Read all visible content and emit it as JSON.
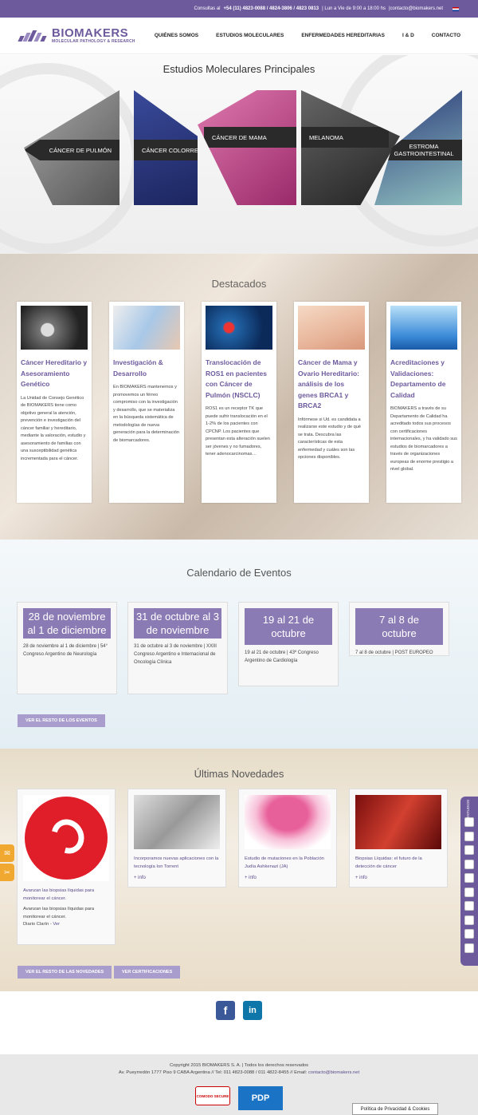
{
  "topbar": {
    "prefix": "Consultas al",
    "phones": "+54 (11) 4823-0088 / 4824-3806 / 4823 0813",
    "hours": "| Lun a Vie de 9:00 a 18:00 hs",
    "email": "|contacto@biomakers.net"
  },
  "logo": {
    "name": "BIOMAKERS",
    "sub": "MOLECULAR PATHOLOGY & RESEARCH"
  },
  "menu": [
    "QUIÉNES SOMOS",
    "ESTUDIOS MOLECULARES",
    "ENFERMEDADES HEREDITARIAS",
    "I & D",
    "CONTACTO"
  ],
  "estudios": {
    "title": "Estudios Moleculares Principales",
    "panels": [
      "CÁNCER DE PULMÓN",
      "CÁNCER COLORRECTAL",
      "CÁNCER DE MAMA",
      "MELANOMA",
      "ESTROMA GASTROINTESTINAL"
    ]
  },
  "destacados": {
    "title": "Destacados",
    "cards": [
      {
        "title": "Cáncer Hereditario y Asesoramiento Genético",
        "text": "La Unidad de Consejo Genético de BIOMAKERS tiene como objetivo general la atención, prevención e investigación del cáncer familiar y hereditario, mediante la valoración, estudio y asesoramiento de familias con una susceptibilidad genética incrementada para el cáncer."
      },
      {
        "title": "Investigación & Desarrollo",
        "text": "En BIOMAKERS mantenemos y promovemos un férreo compromiso con la investigación y desarrollo, que se materializa en la búsqueda sistemática de metodologías de nueva generación para la determinación de biomarcadores."
      },
      {
        "title": "Translocación de ROS1 en pacientes con Cáncer de Pulmón (NSCLC)",
        "text": "ROS1 es un receptor TK que puede sufrir translocación en el 1-2% de los pacientes con CPCNP. Los pacientes que presentan esta alteración suelen ser jóvenes y no fumadores, tener adenocarcinomas…"
      },
      {
        "title": "Cáncer de Mama y Ovario Hereditario: análisis de los genes BRCA1 y BRCA2",
        "text": "Infórmese si Ud. es candidata a realizarse este estudio y de qué se trata. Descubra las características de esta enfermedad y cuáles son las opciones disponibles."
      },
      {
        "title": "Acreditaciones y Validaciones: Departamento de Calidad",
        "text": "BIOMAKERS a través de su Departamento de Calidad ha acreditado todos sus procesos con certificaciones internacionales, y ha validado sus estudios de biomarcadores a través de organizaciones europeas de enorme prestigio a nivel global."
      }
    ]
  },
  "eventos": {
    "title": "Calendario de Eventos",
    "button": "VER EL RESTO DE LOS EVENTOS",
    "items": [
      {
        "date": "28 de noviembre al 1 de diciembre",
        "desc": "28 de noviembre al 1 de diciembre | 54° Congreso Argentino de Neurología"
      },
      {
        "date": "31 de octubre al 3 de noviembre",
        "desc": "31 de octubre al 3 de noviembre | XXIII Congreso Argentino e Internacional de Oncología Clínica"
      },
      {
        "date": "19 al 21 de octubre",
        "desc": "19 al 21 de octubre | 43º Congreso Argentino de Cardiología"
      },
      {
        "date": "7 al 8 de octubre",
        "desc": "7 al 8 de octubre | POST EUROPEO"
      }
    ]
  },
  "novedades": {
    "title": "Últimas Novedades",
    "button1": "VER EL RESTO DE LAS NOVEDADES",
    "button2": "VER CERTIFICACIONES",
    "items": [
      {
        "title": "Avanzan las biopsias líquidas para monitorear el cáncer.",
        "extra": "Avanzan las biopsias líquidas para monitorear el cáncer.",
        "source": "Diario Clarín -",
        "link": "Ver"
      },
      {
        "title": "Incorporamos nuevas aplicaciones con la tecnología Ion Torrent",
        "more": "+ info"
      },
      {
        "title": "Estudio de mutaciones en la Población Judía Ashkenazi (JA)",
        "more": "+ info"
      },
      {
        "title": "Biopsias Líquidas: el futuro de la detección de cáncer",
        "more": "+ info"
      }
    ]
  },
  "footer": {
    "line1": "Copyright 2015 BIOMAKERS S. A. | Todos los derechos reservados",
    "line2": "Av. Pueyrredón 1777 Piso 9 CABA Argentina // Tel: 011 4823-0088 / 011 4822-8455 // Email:",
    "email": "contacto@biomakers.net",
    "comodo": "COMODO SECURE",
    "pdp": "PDP"
  },
  "sidebar": {
    "label": "ESTUDIOS"
  },
  "cookie": "Política de Privacidad & Cookies",
  "colors": {
    "brand": "#6d5a9d",
    "event": "#8b7bb5"
  }
}
